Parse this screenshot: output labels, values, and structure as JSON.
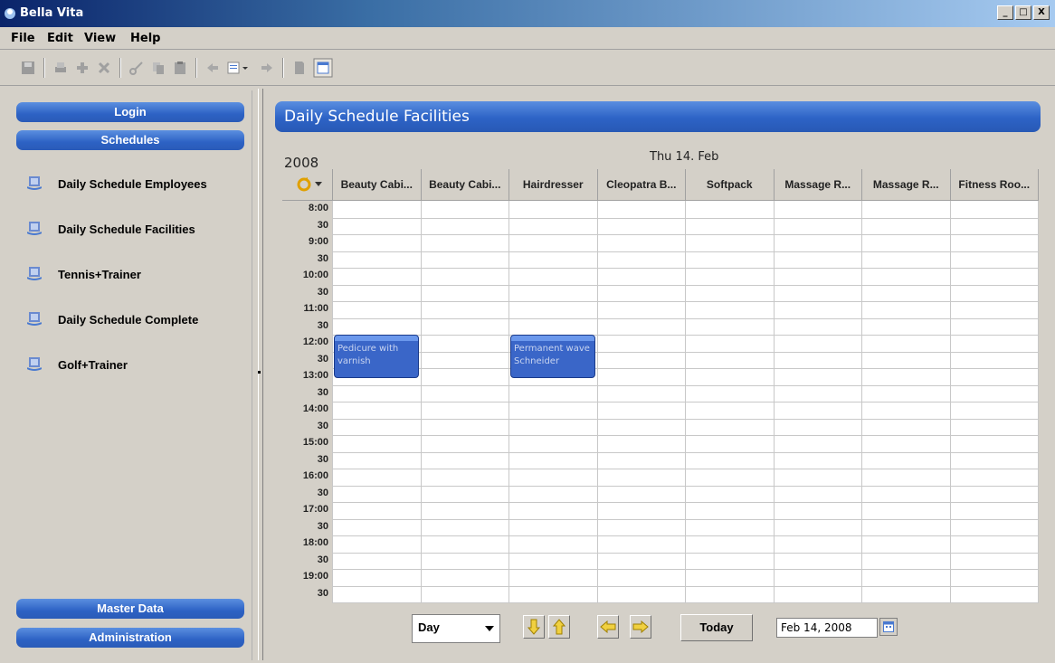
{
  "window": {
    "title": "Bella Vita",
    "min": "_",
    "max": "□",
    "close": "X"
  },
  "menu": [
    "File",
    "Edit",
    "View",
    "Help"
  ],
  "toolbar_icons": [
    "save-icon",
    "print-icon",
    "add-icon",
    "delete-icon",
    "cut-icon",
    "copy-icon",
    "paste-icon",
    "back-icon",
    "list-icon",
    "forward-icon",
    "document-icon",
    "layout-icon"
  ],
  "sidebar": {
    "login": "Login",
    "schedules": "Schedules",
    "items": [
      {
        "label": "Daily Schedule Employees"
      },
      {
        "label": "Daily Schedule Facilities"
      },
      {
        "label": "Tennis+Trainer"
      },
      {
        "label": "Daily Schedule Complete"
      },
      {
        "label": "Golf+Trainer"
      }
    ],
    "master_data": "Master Data",
    "administration": "Administration"
  },
  "main": {
    "title": "Daily Schedule Facilities",
    "year": "2008",
    "day": "Thu 14. Feb",
    "columns": [
      "Beauty Cabi...",
      "Beauty Cabi...",
      "Hairdresser",
      "Cleopatra B...",
      "Softpack",
      "Massage R...",
      "Massage R...",
      "Fitness Roo..."
    ],
    "times": [
      "8:00",
      "30",
      "9:00",
      "30",
      "10:00",
      "30",
      "11:00",
      "30",
      "12:00",
      "30",
      "13:00",
      "30",
      "14:00",
      "30",
      "15:00",
      "30",
      "16:00",
      "30",
      "17:00",
      "30",
      "18:00",
      "30",
      "19:00",
      "30"
    ],
    "appointments": [
      {
        "column": 0,
        "text": "Pedicure with varnish"
      },
      {
        "column": 2,
        "text": "Permanent wave Schneider"
      }
    ]
  },
  "footer": {
    "view": "Day",
    "today": "Today",
    "date": "Feb 14, 2008"
  },
  "colors": {
    "accent": "#2d63c6",
    "appointment": "#3a66c8"
  }
}
